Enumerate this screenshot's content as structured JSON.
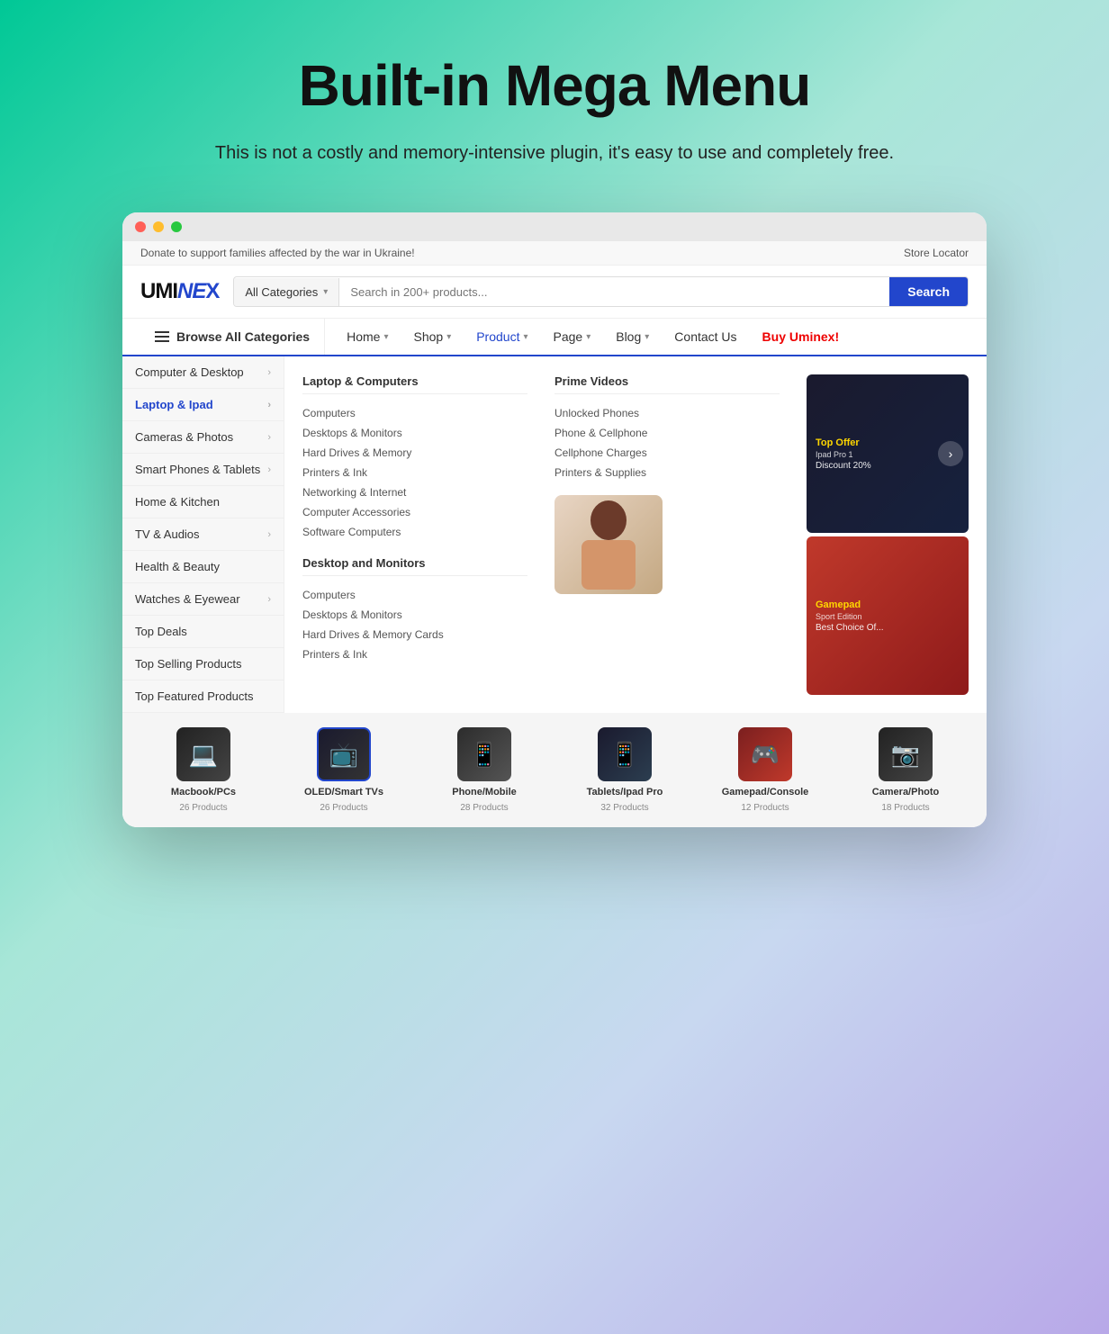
{
  "hero": {
    "title": "Built-in Mega Menu",
    "subtitle": "This is not a costly and memory-intensive plugin, it's easy to use and completely free."
  },
  "topbar": {
    "left_text": "Donate to support families affected by the war in Ukraine!",
    "right_text": "Store Locator"
  },
  "header": {
    "logo": "UMINEX",
    "search_placeholder": "Search in 200+ products...",
    "categories_label": "All Categories",
    "search_button": "Search"
  },
  "nav": {
    "browse_label": "Browse All Categories",
    "links": [
      {
        "label": "Home",
        "has_dropdown": true
      },
      {
        "label": "Shop",
        "has_dropdown": true
      },
      {
        "label": "Product",
        "has_dropdown": true
      },
      {
        "label": "Page",
        "has_dropdown": true
      },
      {
        "label": "Blog",
        "has_dropdown": true
      },
      {
        "label": "Contact Us",
        "has_dropdown": false
      },
      {
        "label": "Buy Uminex!",
        "has_dropdown": false,
        "special": "buy"
      }
    ]
  },
  "sidebar": {
    "items": [
      {
        "label": "Computer & Desktop",
        "has_arrow": true,
        "active": false
      },
      {
        "label": "Laptop & Ipad",
        "has_arrow": true,
        "active": true
      },
      {
        "label": "Cameras & Photos",
        "has_arrow": true,
        "active": false
      },
      {
        "label": "Smart Phones & Tablets",
        "has_arrow": true,
        "active": false
      },
      {
        "label": "Home & Kitchen",
        "has_arrow": false,
        "active": false
      },
      {
        "label": "TV & Audios",
        "has_arrow": true,
        "active": false
      },
      {
        "label": "Health & Beauty",
        "has_arrow": false,
        "active": false
      },
      {
        "label": "Watches & Eyewear",
        "has_arrow": true,
        "active": false
      },
      {
        "label": "Top Deals",
        "has_arrow": false,
        "active": false
      },
      {
        "label": "Top Selling Products",
        "has_arrow": false,
        "active": false
      },
      {
        "label": "Top Featured Products",
        "has_arrow": false,
        "active": false
      }
    ]
  },
  "mega_menu": {
    "columns": [
      {
        "title": "Laptop & Computers",
        "links": [
          "Computers",
          "Desktops & Monitors",
          "Hard Drives & Memory",
          "Printers & Ink",
          "Networking & Internet",
          "Computer Accessories",
          "Software Computers"
        ]
      },
      {
        "title": "Desktop and Monitors",
        "links": [
          "Computers",
          "Desktops & Monitors",
          "Hard Drives & Memory Cards",
          "Printers & Ink"
        ]
      },
      {
        "title": "Prime Videos",
        "links": [
          "Unlocked Phones",
          "Phone & Cellphone",
          "Cellphone Charges",
          "Printers & Supplies"
        ]
      }
    ]
  },
  "promo_cards": [
    {
      "title": "Top Offer",
      "subtitle": "Ipad Pro 1",
      "discount": "Discount 20%",
      "style": "dark"
    },
    {
      "title": "Gamepad",
      "subtitle": "Sport Edition",
      "discount": "Best Choice Of...",
      "style": "red"
    }
  ],
  "products": [
    {
      "name": "Macbook/PCs",
      "count": "26 Products",
      "type": "laptop",
      "highlighted": false
    },
    {
      "name": "OLED/Smart TVs",
      "count": "26 Products",
      "type": "tv",
      "highlighted": true
    },
    {
      "name": "Phone/Mobile",
      "count": "28 Products",
      "type": "phone",
      "highlighted": false
    },
    {
      "name": "Tablets/Ipad Pro",
      "count": "32 Products",
      "type": "tablet",
      "highlighted": false
    },
    {
      "name": "Gamepad/Console",
      "count": "12 Products",
      "type": "gamepad",
      "highlighted": false
    },
    {
      "name": "Camera/Photo",
      "count": "18 Products",
      "type": "camera",
      "highlighted": false
    }
  ]
}
